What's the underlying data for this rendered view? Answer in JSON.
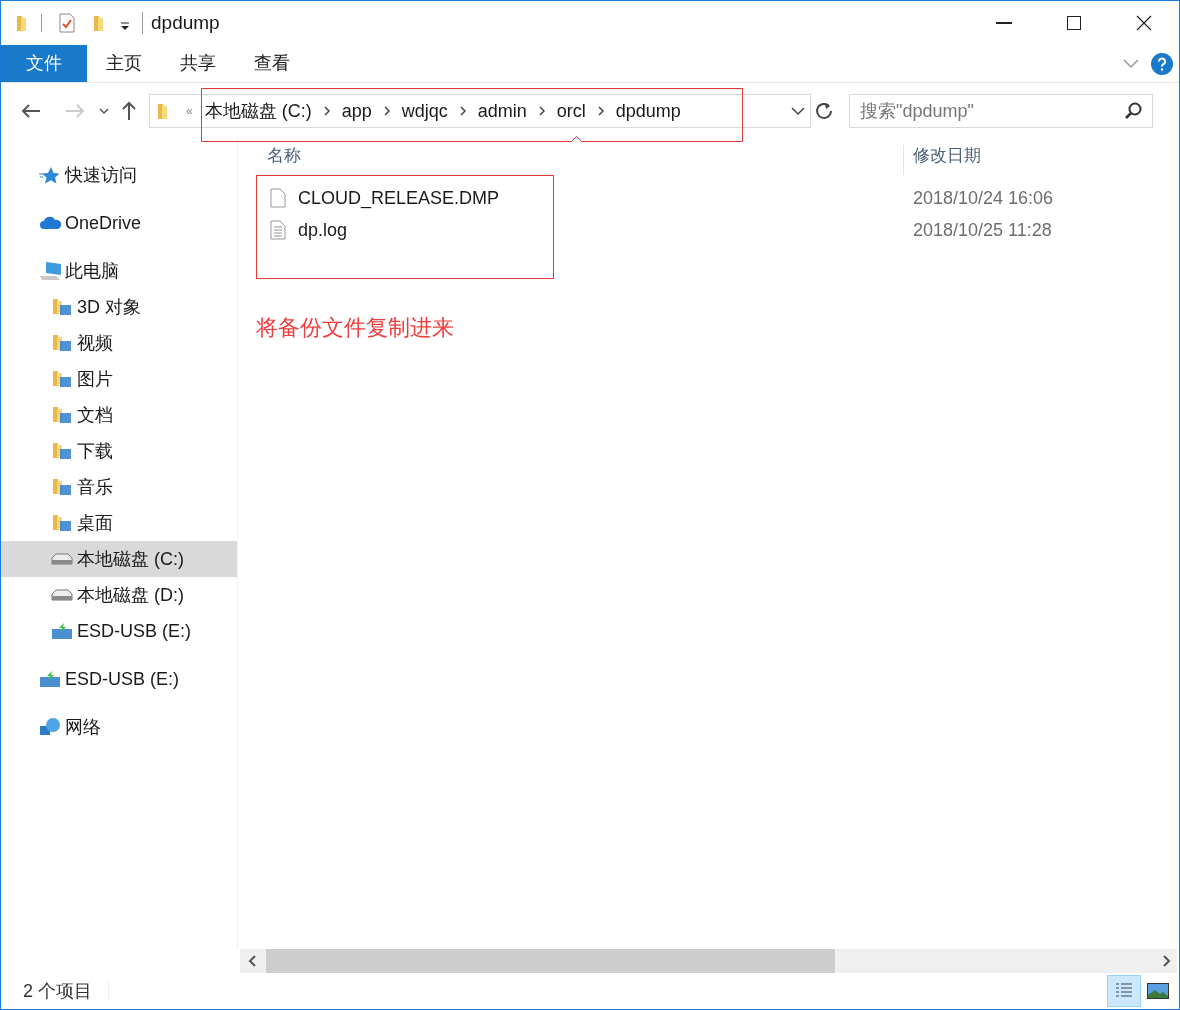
{
  "window": {
    "title": "dpdump"
  },
  "ribbon_tabs": [
    {
      "label": "文件",
      "selected": true
    },
    {
      "label": "主页",
      "selected": false
    },
    {
      "label": "共享",
      "selected": false
    },
    {
      "label": "查看",
      "selected": false
    }
  ],
  "address_bar": {
    "overflow": "«",
    "path": [
      "本地磁盘 (C:)",
      "app",
      "wdjqc",
      "admin",
      "orcl",
      "dpdump"
    ]
  },
  "search": {
    "placeholder": "搜索\"dpdump\""
  },
  "sidebar": {
    "items": [
      {
        "label": "快速访问",
        "kind": "star",
        "selected": false
      },
      {
        "label": "OneDrive",
        "kind": "cloud",
        "selected": false
      },
      {
        "label": "此电脑",
        "kind": "computer",
        "selected": false,
        "children": [
          {
            "label": "3D 对象",
            "kind": "folder",
            "selected": false
          },
          {
            "label": "视频",
            "kind": "folder",
            "selected": false
          },
          {
            "label": "图片",
            "kind": "folder",
            "selected": false
          },
          {
            "label": "文档",
            "kind": "folder",
            "selected": false
          },
          {
            "label": "下载",
            "kind": "folder",
            "selected": false
          },
          {
            "label": "音乐",
            "kind": "folder",
            "selected": false
          },
          {
            "label": "桌面",
            "kind": "folder",
            "selected": false
          },
          {
            "label": "本地磁盘 (C:)",
            "kind": "drive",
            "selected": true
          },
          {
            "label": "本地磁盘 (D:)",
            "kind": "drive",
            "selected": false
          },
          {
            "label": "ESD-USB (E:)",
            "kind": "usb",
            "selected": false
          }
        ]
      },
      {
        "label": "ESD-USB (E:)",
        "kind": "usb",
        "selected": false
      },
      {
        "label": "网络",
        "kind": "network",
        "selected": false
      }
    ]
  },
  "file_list": {
    "columns": [
      "名称",
      "修改日期"
    ],
    "rows": [
      {
        "name": "CLOUD_RELEASE.DMP",
        "kind": "file",
        "modified": "2018/10/24 16:06"
      },
      {
        "name": "dp.log",
        "kind": "text",
        "modified": "2018/10/25 11:28"
      }
    ]
  },
  "annotation": {
    "text": "将备份文件复制进来"
  },
  "status_bar": {
    "item_count": "2 个项目"
  }
}
